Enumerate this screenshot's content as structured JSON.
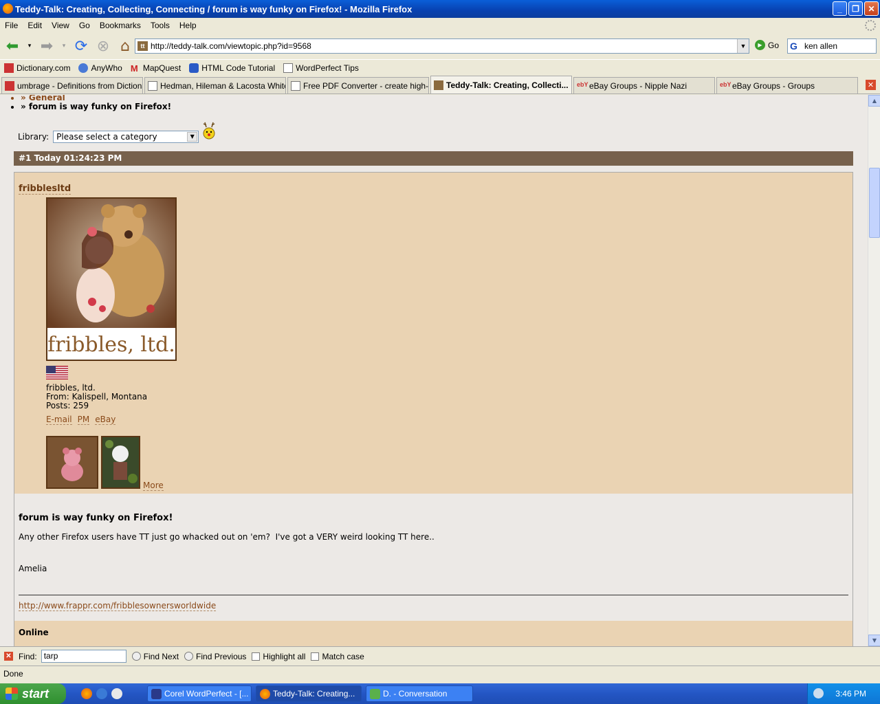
{
  "window": {
    "title": "Teddy-Talk: Creating, Collecting, Connecting / forum is way funky on Firefox! - Mozilla Firefox"
  },
  "menu": [
    "File",
    "Edit",
    "View",
    "Go",
    "Bookmarks",
    "Tools",
    "Help"
  ],
  "nav": {
    "url": "http://teddy-talk.com/viewtopic.php?id=9568",
    "go_label": "Go",
    "search_value": "ken allen"
  },
  "bookmarks": [
    "Dictionary.com",
    "AnyWho",
    "MapQuest",
    "HTML Code Tutorial",
    "WordPerfect Tips"
  ],
  "tabs": [
    {
      "label": "umbrage - Definitions from Dictiona..."
    },
    {
      "label": "Hedman, Hileman & Lacosta Whitef..."
    },
    {
      "label": "Free PDF Converter - create high-..."
    },
    {
      "label": "Teddy-Talk: Creating, Collecti..."
    },
    {
      "label": "eBay Groups - Nipple Nazi"
    },
    {
      "label": "eBay Groups - Groups"
    }
  ],
  "page": {
    "crumb1": "» General",
    "crumb2": "» forum is way funky on Firefox!",
    "library_label": "Library:",
    "library_select": "Please select a category",
    "post_header": "#1 Today 01:24:23 PM",
    "username": "fribblesltd",
    "avatar_text": "fribbles, ltd.",
    "info_name": "fribbles, ltd.",
    "info_from": "From: Kalispell, Montana",
    "info_posts": "Posts: 259",
    "links": [
      "E-mail",
      "PM",
      "eBay"
    ],
    "more": "More",
    "subject": "forum is way funky on Firefox!",
    "body1": "Any other Firefox users have TT just go whacked out on 'em?  I've got a VERY weird looking TT here..",
    "body2": "Amelia",
    "sig_link": "http://www.frappr.com/fribblesownersworldwide",
    "online": "Online"
  },
  "find": {
    "label": "Find:",
    "value": "tarp",
    "next": "Find Next",
    "previous": "Find Previous",
    "highlight": "Highlight all",
    "match_case": "Match case"
  },
  "status": "Done",
  "taskbar": {
    "start": "start",
    "tasks": [
      "Corel WordPerfect - [...",
      "Teddy-Talk: Creating...",
      "D. - Conversation"
    ],
    "clock": "3:46 PM"
  }
}
